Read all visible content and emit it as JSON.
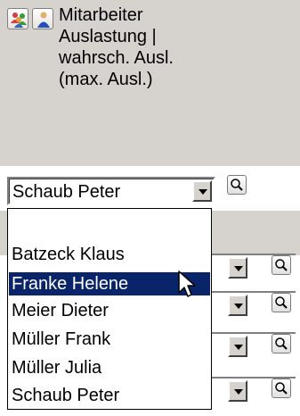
{
  "header": {
    "title_lines": [
      "Mitarbeiter",
      "Auslastung |",
      "wahrsch. Ausl.",
      "(max. Ausl.)"
    ],
    "icons": [
      "group-users-icon",
      "single-user-icon"
    ]
  },
  "employee_select": {
    "selected_value": "Schaub Peter",
    "options": [
      "",
      "Batzeck Klaus",
      "Franke Helene",
      "Meier Dieter",
      "Müller Frank",
      "Müller Julia",
      "Schaub Peter"
    ],
    "highlighted_index": 2
  },
  "colors": {
    "header_bg": "#d6d3ce",
    "highlight_bg": "#0a246a",
    "highlight_text": "#ffffff"
  }
}
